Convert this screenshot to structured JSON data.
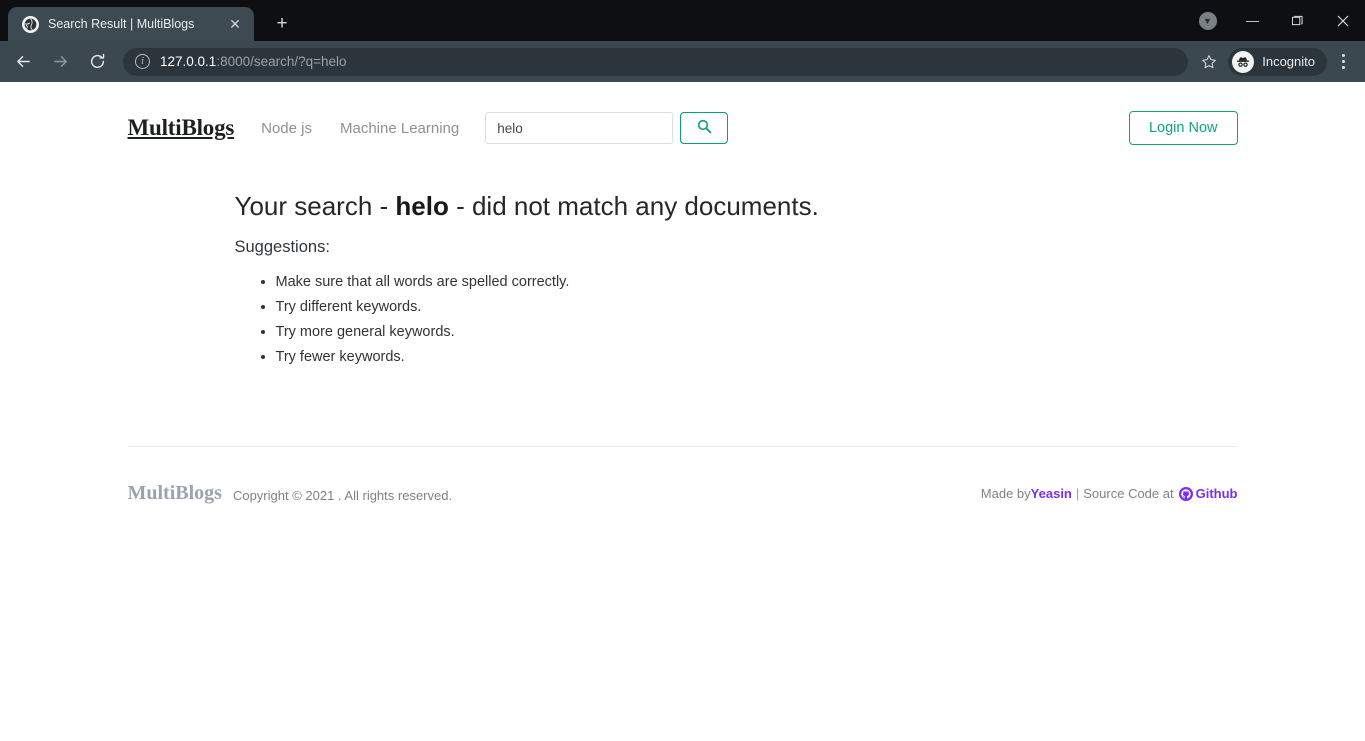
{
  "browser": {
    "tab": {
      "title": "Search Result | MultiBlogs",
      "favicon": "globe-icon",
      "close_label": "✕"
    },
    "new_tab_label": "+",
    "nav": {
      "back_label": "←",
      "forward_label": "→",
      "reload_label": "⟳"
    },
    "omnibox": {
      "info_icon": "info-icon",
      "url_host": "127.0.0.1",
      "url_path": ":8000/search/?q=helo",
      "full_url": "127.0.0.1:8000/search/?q=helo"
    },
    "bookmark_label": "☆",
    "incognito_label": "Incognito",
    "window": {
      "update_badge": "▼",
      "minimize_label": "—",
      "maximize_label": "❐",
      "close_label": "✕"
    }
  },
  "header": {
    "logo": "MultiBlogs",
    "nav_items": [
      {
        "label": "Node js"
      },
      {
        "label": "Machine Learning"
      }
    ],
    "search": {
      "value": "helo",
      "placeholder": "",
      "button_icon": "search-icon"
    },
    "login_label": "Login Now"
  },
  "main": {
    "result_prefix": "Your search - ",
    "query": "helo",
    "result_suffix": " - did not match any documents.",
    "suggestions_label": "Suggestions:",
    "suggestions": [
      "Make sure that all words are spelled correctly.",
      "Try different keywords.",
      "Try more general keywords.",
      "Try fewer keywords."
    ]
  },
  "footer": {
    "logo": "MultiBlogs",
    "copyright": "Copyright © 2021 . All rights reserved.",
    "made_by_prefix": "Made by ",
    "author": "Yeasin",
    "separator": "|",
    "source_label": "Source Code at",
    "github_label": "Github",
    "github_icon": "github-icon"
  },
  "colors": {
    "accent_teal": "#0fa47e",
    "accent_purple": "#7b2ff2",
    "chrome_tabstrip": "#0d0f13",
    "chrome_toolbar": "#3b4850",
    "active_tab": "#3d4a52"
  }
}
